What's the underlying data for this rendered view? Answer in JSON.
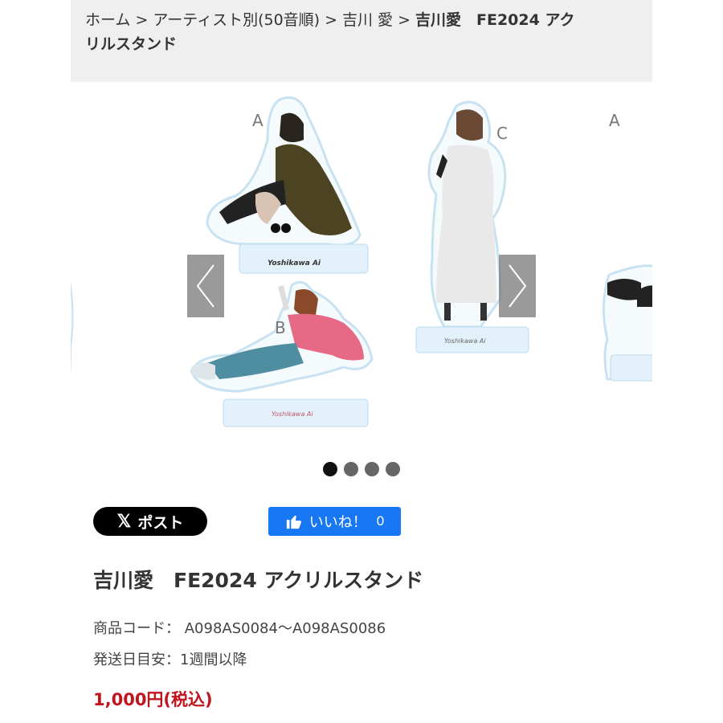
{
  "breadcrumb": {
    "home": "ホーム",
    "artist_index": "アーティスト別(50音順)",
    "artist": "吉川 愛",
    "current_line1": "吉川愛　FE2024 アク",
    "current_line2": "リルスタンド",
    "separator": ">"
  },
  "slider": {
    "labels": {
      "a1": "A",
      "b": "B",
      "c": "C",
      "a2": "A"
    },
    "stand_logo": "Yoshikawa Ai",
    "dots_total": 4,
    "dots_active": 1
  },
  "share": {
    "x_label": "ポスト",
    "like_label": "いいね！",
    "like_count": "0"
  },
  "product": {
    "title": "吉川愛　FE2024 アクリルスタンド",
    "code_label": "商品コード：",
    "code_value": "A098AS0084〜A098AS0086",
    "ship_label": "発送日目安：",
    "ship_value": "1週間以降",
    "price": "1,000円(税込)"
  },
  "colors": {
    "breadcrumb_bg": "#efefef",
    "price": "#c0141e",
    "fb_blue": "#1877f2",
    "acrylic_base": "#e3f1fa"
  }
}
